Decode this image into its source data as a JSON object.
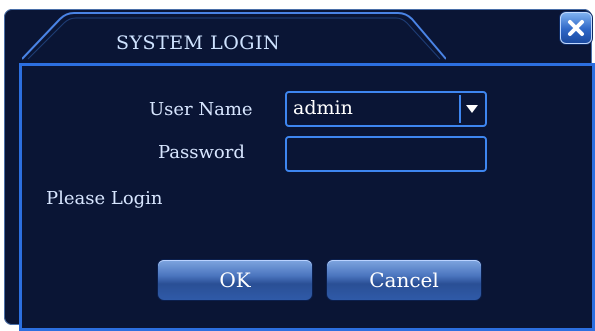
{
  "window": {
    "title": "SYSTEM LOGIN"
  },
  "form": {
    "username_label": "User Name",
    "username_value": "admin",
    "password_label": "Password",
    "password_value": "",
    "status_text": "Please Login"
  },
  "buttons": {
    "ok_label": "OK",
    "cancel_label": "Cancel"
  },
  "icons": {
    "close": "close-icon",
    "dropdown": "chevron-down-icon"
  },
  "colors": {
    "background": "#0a1535",
    "accent": "#2c6fe0",
    "text": "#d8e6ff"
  }
}
